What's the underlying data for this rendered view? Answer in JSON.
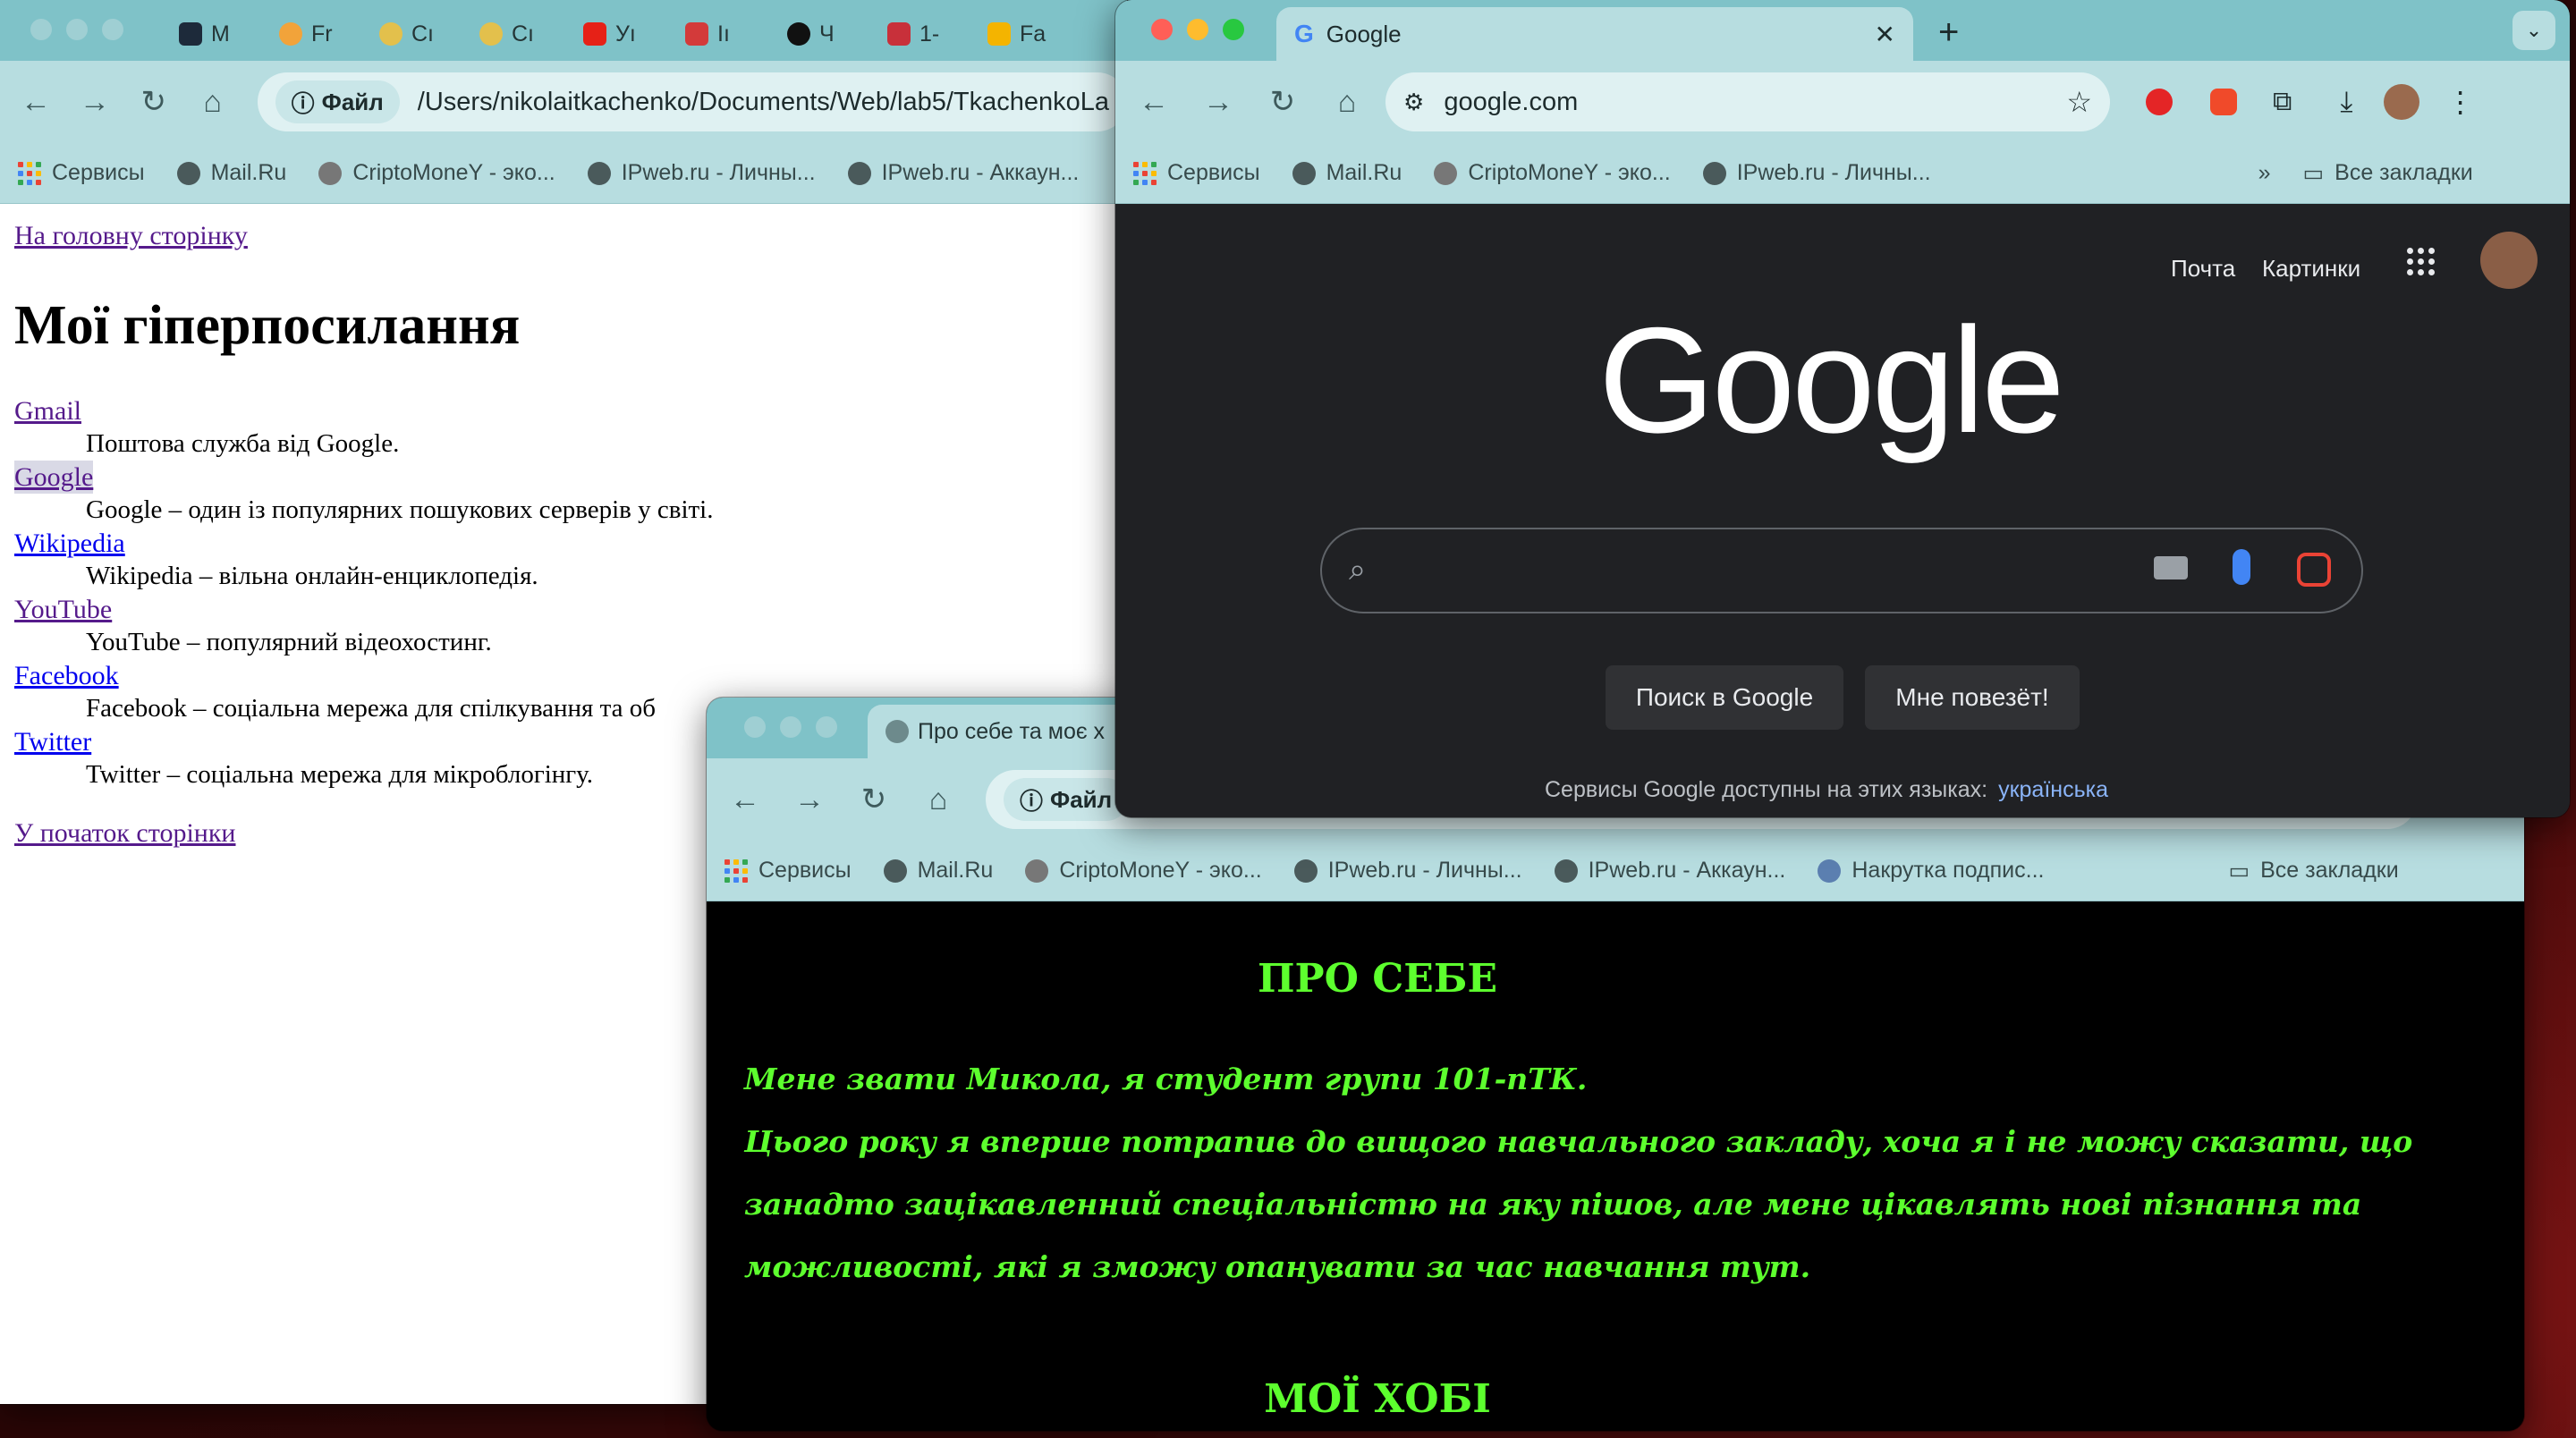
{
  "desktop": {
    "accent": "#7a1414"
  },
  "window_a": {
    "tabs": [
      "M",
      "Fr",
      "Cı",
      "Cı",
      "Уı",
      "Iı",
      "Ч",
      "1-",
      "Fa"
    ],
    "file_chip": "Файл",
    "url": "/Users/nikolaitkachenko/Documents/Web/lab5/TkachenkoLa",
    "bookmarks": [
      "Сервисы",
      "Mail.Ru",
      "CriptoMoneY - эко...",
      "IPweb.ru - Личны...",
      "IPweb.ru - Аккаун..."
    ],
    "page": {
      "top_link": "На головну сторінку",
      "title": "Мої гіперпосилання",
      "items": [
        {
          "term": "Gmail",
          "desc": "Поштова служба від Google."
        },
        {
          "term": "Google",
          "desc": "Google – один із популярних пошукових серверів у світі."
        },
        {
          "term": "Wikipedia",
          "desc": "Wikipedia – вільна онлайн-енциклопедія."
        },
        {
          "term": "YouTube",
          "desc": "YouTube – популярний відеохостинг."
        },
        {
          "term": "Facebook",
          "desc": "Facebook – соціальна мережа для спілкування та об"
        },
        {
          "term": "Twitter",
          "desc": "Twitter – соціальна мережа для мікроблогінгу."
        }
      ],
      "bottom_link": "У початок сторінки"
    }
  },
  "window_b": {
    "tab_title": "Google",
    "url": "google.com",
    "bookmarks": [
      "Сервисы",
      "Mail.Ru",
      "CriptoMoneY - эко...",
      "IPweb.ru - Личны..."
    ],
    "all_bookmarks": "Все закладки",
    "header_links": {
      "mail": "Почта",
      "images": "Картинки"
    },
    "logo": "Google",
    "buttons": {
      "search": "Поиск в Google",
      "lucky": "Мне повезёт!"
    },
    "lang_text": "Сервисы Google доступны на этих языках:",
    "lang_link": "українська"
  },
  "window_c": {
    "tab_title": "Про себе та моє х",
    "file_chip": "Файл",
    "bookmarks": [
      "Сервисы",
      "Mail.Ru",
      "CriptoMoneY - эко...",
      "IPweb.ru - Личны...",
      "IPweb.ru - Аккаун...",
      "Накрутка подпис..."
    ],
    "all_bookmarks": "Все закладки",
    "page": {
      "heading": "ПРО СЕБЕ",
      "line1": "Мене звати Микола, я студент групи 101-пТК.",
      "line2": "Цього року я вперше потрапив до вищого навчального закладу, хоча я і не можу сказати, що",
      "line3": "занадто зацікавленний спеціальністю на яку пішов, але мене цікавлять нові пізнання та",
      "line4": "можливості, які я зможу опанувати за час навчання тут.",
      "heading2": "МОЇ ХОБІ"
    }
  }
}
